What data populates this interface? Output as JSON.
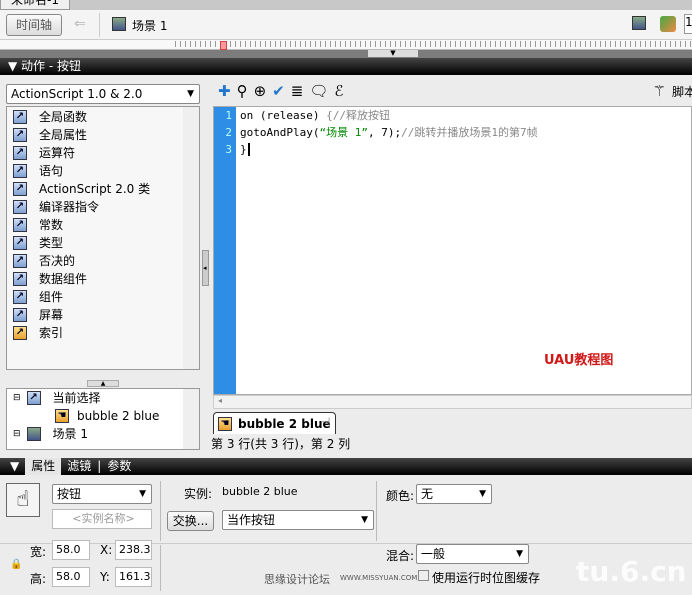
{
  "document_tab": "未命名-1",
  "toolbar": {
    "timeline_button": "时间轴",
    "scene": "场景 1",
    "zoom_partial": "1"
  },
  "actions_panel": {
    "title": "动作 - 按钮",
    "version_select": "ActionScript 1.0 & 2.0",
    "categories": [
      "全局函数",
      "全局属性",
      "运算符",
      "语句",
      "ActionScript 2.0 类",
      "编译器指令",
      "常数",
      "类型",
      "否决的",
      "数据组件",
      "组件",
      "屏幕",
      "索引"
    ],
    "script_assist": "脚本",
    "tree": {
      "current_selection": "当前选择",
      "instance": "bubble 2 blue",
      "scene": "场景 1"
    },
    "code_lines": [
      {
        "num": "1",
        "code": "on (release) ",
        "comment": "{//释放按钮"
      },
      {
        "num": "2",
        "code": "gotoAndPlay(",
        "string": "“场景 1”",
        "code2": ", 7);",
        "comment": "//跳转并播放场景1的第7帧"
      },
      {
        "num": "3",
        "code": "}"
      }
    ],
    "script_tab": "bubble 2 blue",
    "status": "第 3 行(共 3 行)，第 2 列",
    "watermark": "UAU教程图"
  },
  "properties_panel": {
    "tabs": [
      "属性",
      "滤镜",
      "参数"
    ],
    "symbol_type": "按钮",
    "instance_name_placeholder": "<实例名称>",
    "instance_label": "实例:",
    "instance_value": "bubble 2 blue",
    "swap_button": "交换...",
    "behavior_select": "当作按钮",
    "color_label": "颜色:",
    "color_value": "无",
    "width_label": "宽:",
    "width": "58.0",
    "height_label": "高:",
    "height": "58.0",
    "x_label": "X:",
    "x": "238.3",
    "y_label": "Y:",
    "y": "161.3",
    "blend_label": "混合:",
    "blend_value": "一般",
    "cache_label": "使用运行时位图缓存",
    "credit": "思缘设计论坛",
    "credit_url": "WWW.MISSYUAN.COM",
    "watermark": "tu.6.cn"
  }
}
